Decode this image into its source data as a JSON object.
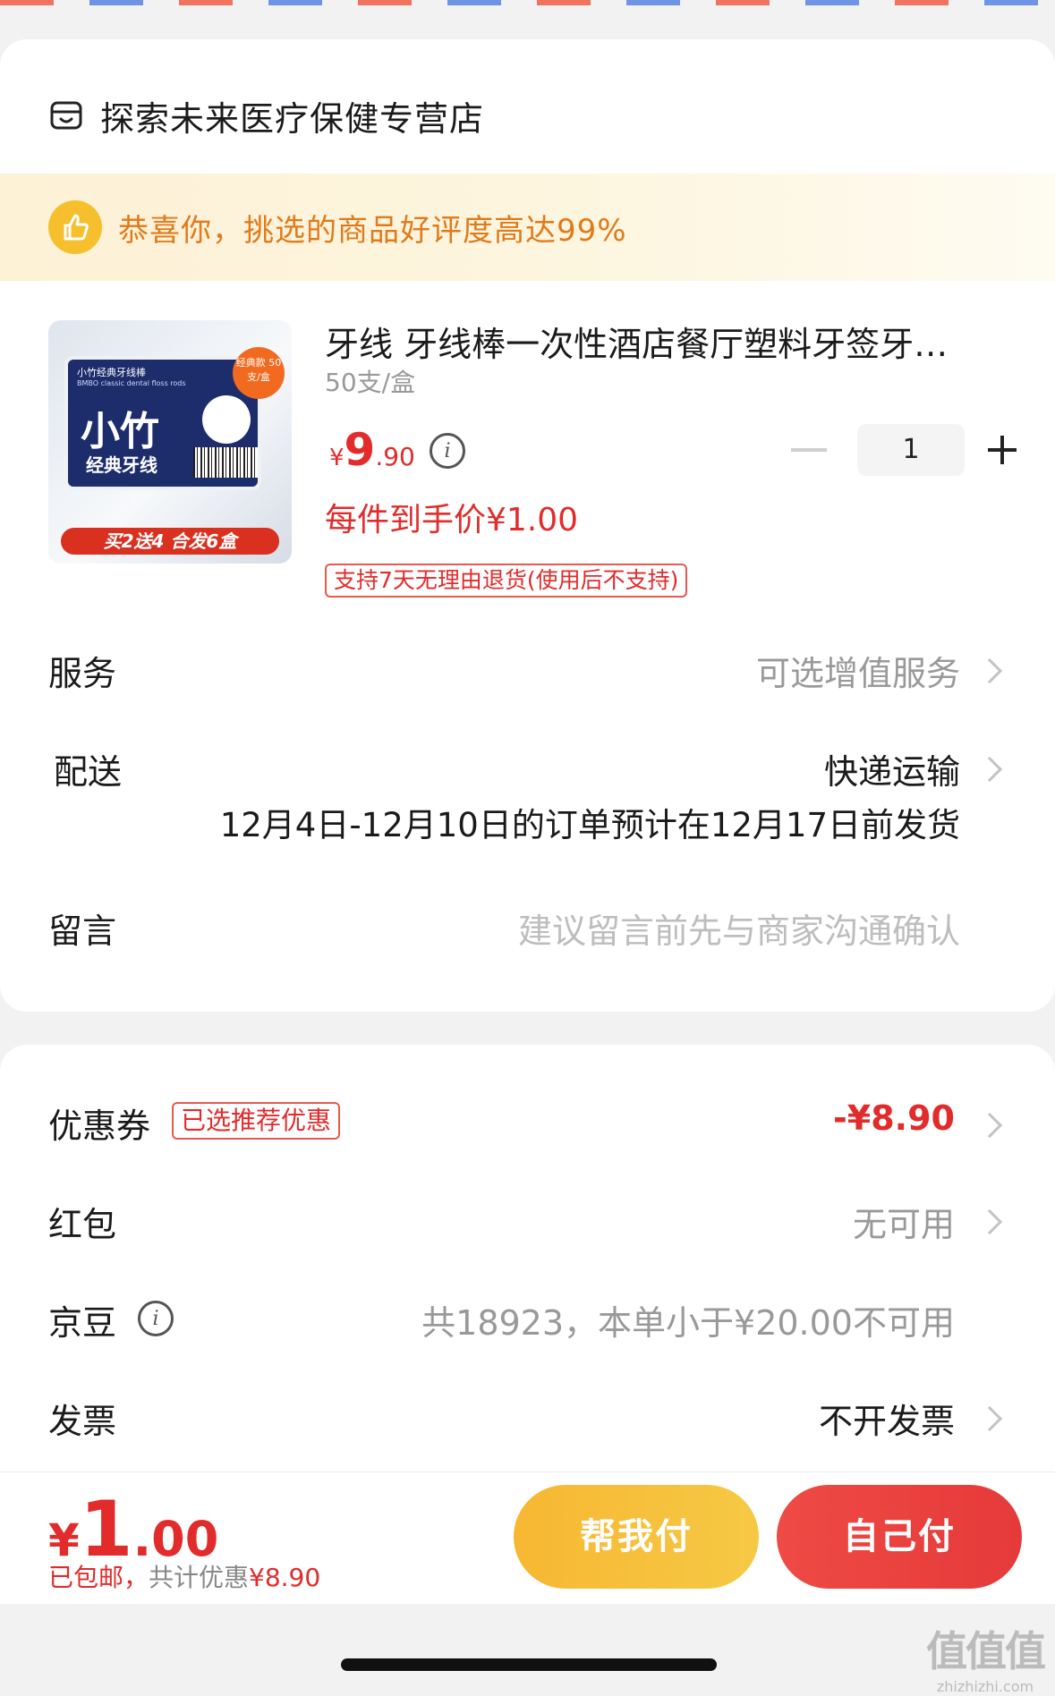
{
  "shop": {
    "name": "探索未来医疗保健专营店",
    "icon": "shop-icon"
  },
  "praise": {
    "text": "恭喜你，挑选的商品好评度高达99%",
    "icon": "thumbs-up-icon"
  },
  "product": {
    "title": "牙线 牙线棒一次性酒店餐厅塑料牙签牙…",
    "spec": "50支/盒",
    "price_currency": "¥",
    "price_int": "9",
    "price_dec": ".90",
    "each_price": "每件到手价¥1.00",
    "return_policy": "支持7天无理由退货(使用后不支持)",
    "quantity": "1",
    "image_texts": {
      "header": "小竹经典牙线棒",
      "header_en": "BMBO classic dental floss rods",
      "brand": "小竹",
      "subtitle": "经典牙线",
      "badge": "经典款 50支/盒",
      "promo": "买2送4 合发6盒"
    }
  },
  "service": {
    "label": "服务",
    "value": "可选增值服务"
  },
  "delivery": {
    "label": "配送",
    "value": "快递运输",
    "note": "12月4日-12月10日的订单预计在12月17日前发货"
  },
  "message": {
    "label": "留言",
    "placeholder": "建议留言前先与商家沟通确认"
  },
  "coupon": {
    "label": "优惠券",
    "tag": "已选推荐优惠",
    "value": "-¥8.90"
  },
  "red_packet": {
    "label": "红包",
    "value": "无可用"
  },
  "jingdou": {
    "label": "京豆",
    "value": "共18923，本单小于¥20.00不可用"
  },
  "invoice": {
    "label": "发票",
    "value": "不开发票"
  },
  "checkout": {
    "currency": "¥",
    "total_int": "1",
    "total_dec": ".00",
    "note_shipping": "已包邮，",
    "note_discount_label": "共计优惠",
    "note_discount": "¥8.90",
    "help_pay": "帮我付",
    "self_pay": "自己付"
  },
  "watermark": {
    "line1": "值值值",
    "line2": "zhizhizhi.com"
  },
  "colors": {
    "accent_red": "#e22b2b",
    "accent_orange": "#e07a1a",
    "gold": "#f6bf2e"
  }
}
